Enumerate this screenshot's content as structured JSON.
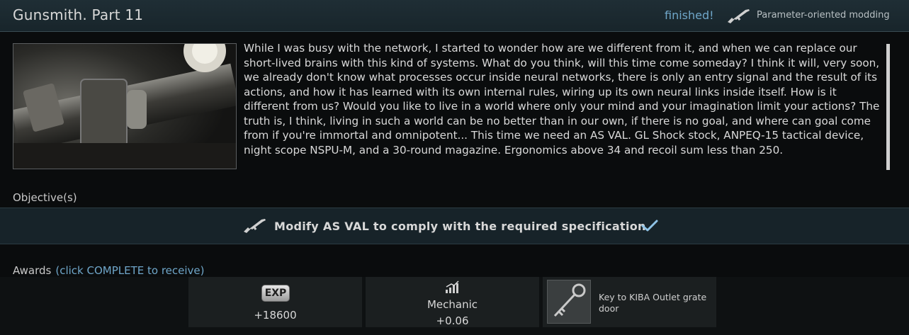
{
  "header": {
    "title": "Gunsmith. Part 11",
    "status": "finished!",
    "quest_type": "Parameter-oriented modding",
    "gun_icon": "rifle-icon"
  },
  "description": "While I was busy with the network, I started to wonder how are we different from it, and when we can replace our short-lived brains with this kind of systems. What do you think, will this time come someday? I think it will, very soon, we already don't know what processes occur inside neural networks, there is only an entry signal and the result of its actions, and how it has learned with its own internal rules, wiring up its own neural links inside itself. How is it different from us? Would you like to live in a world where only your mind and your imagination limit your actions? The truth is, I think, living in such a world can be no better than in our own, if there is no goal, and where can goal come from if you're immortal and omnipotent... This time we need an AS VAL. GL Shock stock, ANPEQ-15 tactical device, night scope NSPU-M, and a 30-round magazine. Ergonomics above 34 and recoil sum less than 250.",
  "objectives": {
    "label": "Objective(s)",
    "items": [
      {
        "text": "Modify AS VAL to comply with the required specification",
        "icon": "rifle-icon",
        "completed": true
      }
    ]
  },
  "awards": {
    "label": "Awards",
    "hint": "(click COMPLETE to receive)",
    "items": [
      {
        "type": "exp",
        "badge": "EXP",
        "value": "+18600"
      },
      {
        "type": "reputation",
        "icon": "reputation-icon",
        "trader": "Mechanic",
        "value": "+0.06"
      },
      {
        "type": "item",
        "icon": "key-icon",
        "name": "Key to KIBA Outlet grate door"
      }
    ]
  },
  "colors": {
    "accent": "#6fa6c9",
    "header_bg": "#1c2a31",
    "objective_bg": "#172329",
    "check": "#8fc3e6"
  }
}
